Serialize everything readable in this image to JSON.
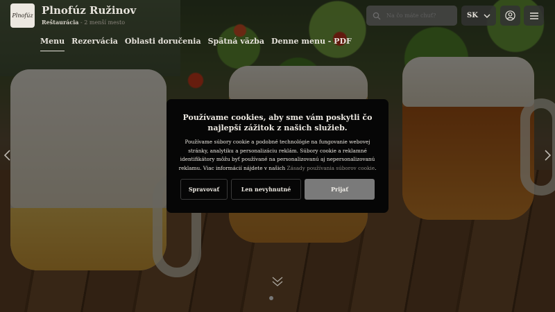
{
  "header": {
    "logo_text": "Plnofúz",
    "brand_name": "Plnofúz Ružinov",
    "brand_type": "Reštaurácia",
    "brand_separator": " - ",
    "brand_location": "2 menší mesto",
    "nav": [
      {
        "label": "Menu",
        "active": true
      },
      {
        "label": "Rezervácia",
        "active": false
      },
      {
        "label": "Oblasti doručenia",
        "active": false
      },
      {
        "label": "Spätná väzba",
        "active": false
      },
      {
        "label": "Denne menu - PDF",
        "active": false
      }
    ],
    "search_placeholder": "Na čo máte chuť?",
    "language": "SK"
  },
  "icons": {
    "search": "search-icon",
    "chevron": "chevron-down-icon",
    "user": "user-icon",
    "menu": "hamburger-icon",
    "arrow_left": "chevron-left-icon",
    "arrow_right": "chevron-right-icon",
    "scroll": "double-chevron-down-icon"
  },
  "cookie": {
    "title": "Používame cookies, aby sme vám poskytli čo najlepší zážitok z našich služieb.",
    "body": "Používame súbory cookie a podobné technológie na fungovanie webovej stránky, analytiku a personalizáciu reklám. Súbory cookie a reklamné identifikátory môžu byť používané na personalizovanú aj nepersonalizovanú reklamu. Viac informácií nájdete v našich ",
    "link_text": "Zásady používania súborov cookie",
    "body_end": ".",
    "buttons": {
      "manage": "Spravovať",
      "necessary": "Len nevyhnutné",
      "accept": "Prijať"
    }
  },
  "colors": {
    "overlay": "#000000",
    "modal_bg": "#060606",
    "accept_button": "#7a7a7a",
    "text_light": "#e7e3dc"
  }
}
